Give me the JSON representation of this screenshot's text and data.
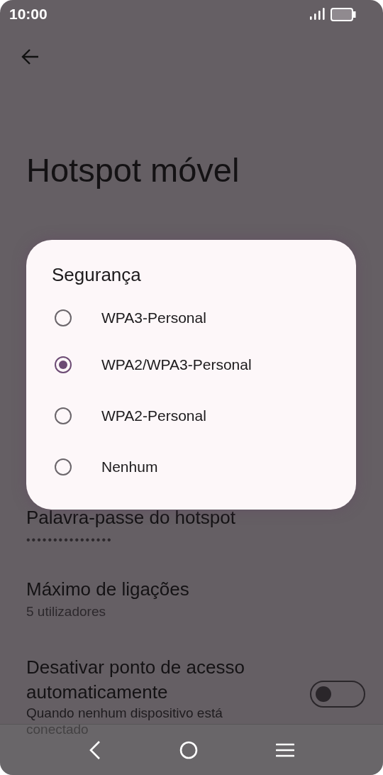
{
  "status_bar": {
    "time": "10:00"
  },
  "title": "Hotspot móvel",
  "settings": [
    {
      "kind": "text",
      "title": "Palavra-passe do hotspot",
      "summary": "••••••••••••••••"
    },
    {
      "kind": "text",
      "title": "Máximo de ligações",
      "summary": "5 utilizadores"
    },
    {
      "kind": "switch",
      "title": "Desativar ponto de acesso automaticamente",
      "summary": "Quando nenhum dispositivo está conectado",
      "on": false
    }
  ],
  "dialog": {
    "title": "Segurança",
    "options": [
      {
        "label": "WPA3-Personal",
        "selected": false
      },
      {
        "label": "WPA2/WPA3-Personal",
        "selected": true
      },
      {
        "label": "WPA2-Personal",
        "selected": false
      },
      {
        "label": "Nenhum",
        "selected": false
      }
    ]
  }
}
